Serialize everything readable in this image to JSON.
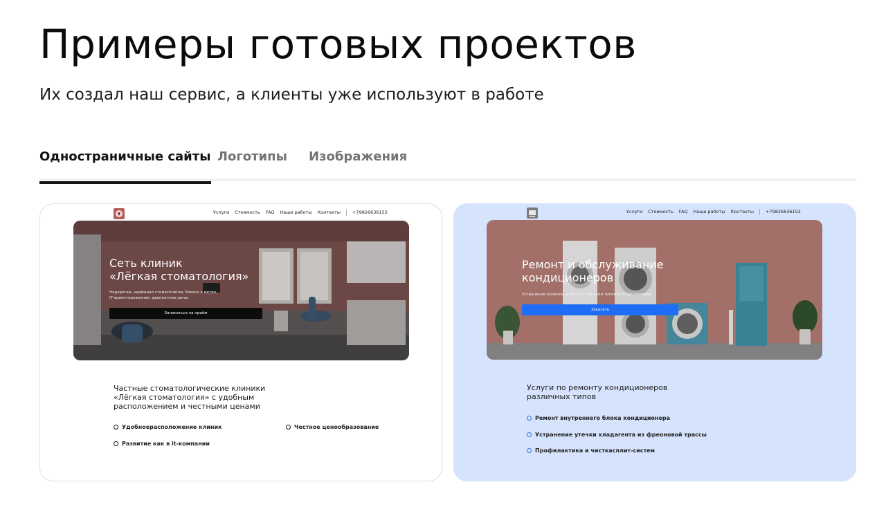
{
  "header": {
    "title": "Примеры готовых проектов",
    "subtitle": "Их создал наш сервис, а клиенты уже используют в работе"
  },
  "tabs": [
    {
      "label": "Одностраничные сайты",
      "active": true
    },
    {
      "label": "Логотипы",
      "active": false
    },
    {
      "label": "Изображения",
      "active": false
    }
  ],
  "cards": [
    {
      "nav": [
        "Услуги",
        "Стоимость",
        "FAQ",
        "Наши работы",
        "Контакты"
      ],
      "phone": "+79826636152",
      "hero_title_1": "Сеть клиник",
      "hero_title_2": "«Лёгкая стоматология»",
      "hero_desc_1": "Недорогая, надёжная стоматология, близко к метро,",
      "hero_desc_2": "IT-ориентированная, адекватные цены.",
      "hero_button": "Записаться на приём",
      "section_title_1": "Частные стоматологические клиники",
      "section_title_2": "«Лёгкая стоматология» с удобным",
      "section_title_3": "расположением и честными ценами",
      "bullets": [
        "Удобноерасположение клиник",
        "Честное ценообразование",
        "Развитие как в it-компании"
      ]
    },
    {
      "nav": [
        "Услуги",
        "Стоимость",
        "FAQ",
        "Наши работы",
        "Контакты"
      ],
      "phone": "+79826636152",
      "hero_title_1": "Ремонт и обслуживание",
      "hero_title_2": "кондиционеров",
      "hero_desc_1": "Устранение поломок, работы с разными типами кондиционеров",
      "hero_button": "Заказать",
      "section_title_1": "Услуги по ремонту кондиционеров",
      "section_title_2": "различных типов",
      "bullets": [
        "Ремонт внутреннего блока кондиционера",
        "Устранение утечки хладагента из фреоновой трассы",
        "Профилактика и чисткасплит-систем"
      ]
    }
  ],
  "colors": {
    "accent_blue": "#1f6cf5",
    "card_blue_bg": "#d5e3fd",
    "dental_wall": "#8a5a59",
    "ac_wall": "#b57e74"
  }
}
